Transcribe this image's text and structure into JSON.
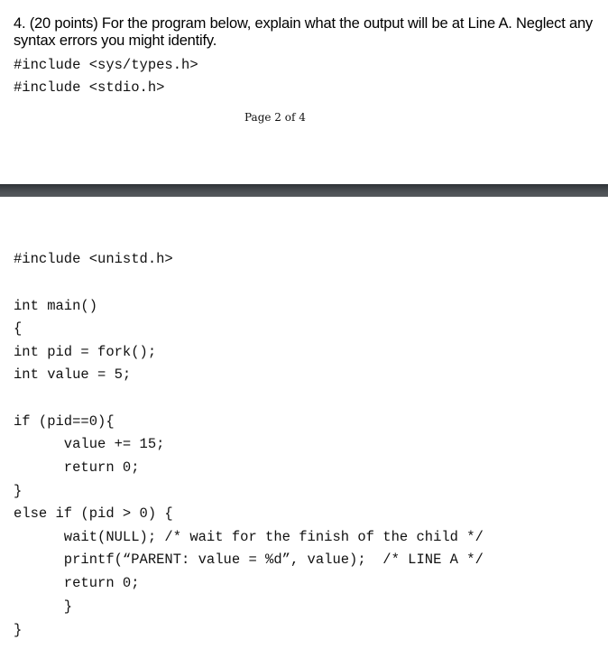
{
  "question": {
    "number": "4.",
    "text": "4. (20 points)  For the program below, explain what the output will be at Line A. Neglect any syntax errors you might identify."
  },
  "page_indicator": "Page 2 of 4",
  "code_lines": [
    "#include <sys/types.h>",
    "#include <stdio.h>",
    "#include <unistd.h>",
    "int main()",
    "{",
    "int pid = fork();",
    "int value = 5;",
    "if (pid==0){",
    "      value += 15;",
    "      return 0;",
    "}",
    "else if (pid > 0) {",
    "      wait(NULL); /* wait for the finish of the child */",
    "      printf(“PARENT: value = %d”, value);  /* LINE A */",
    "      return 0;",
    "      }",
    "}"
  ]
}
